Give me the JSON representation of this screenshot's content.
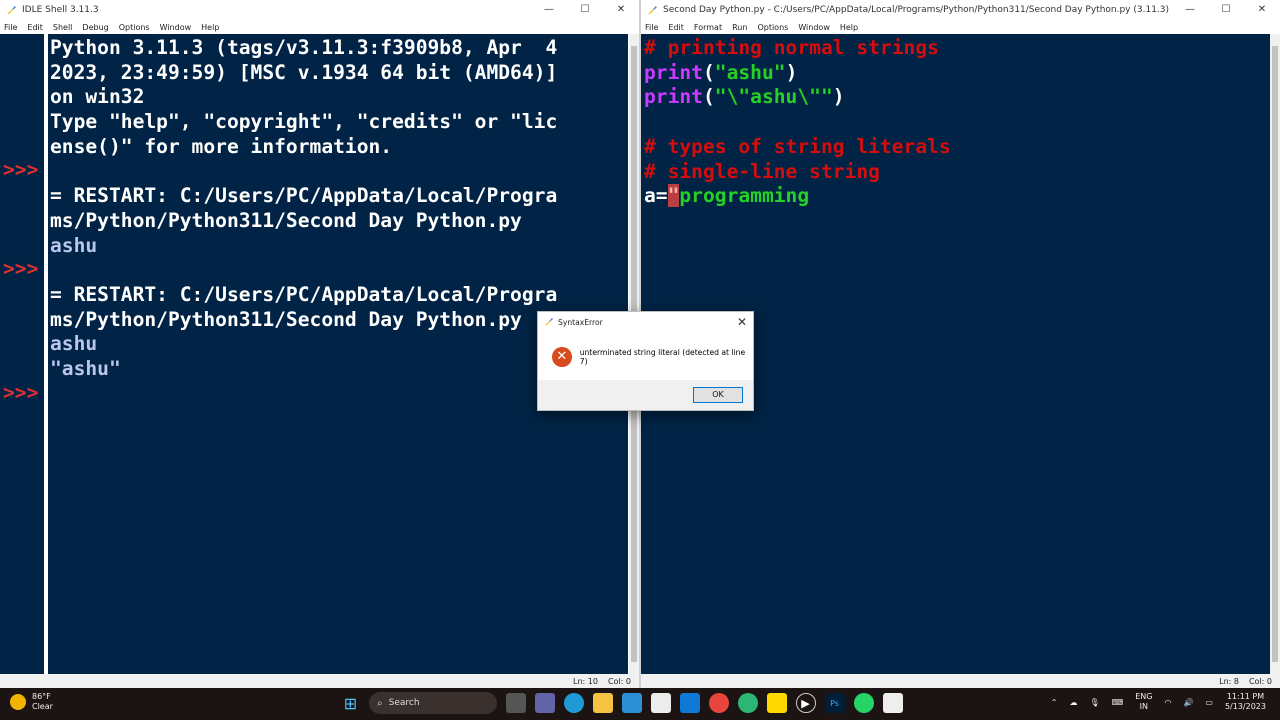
{
  "shell": {
    "title": "IDLE Shell 3.11.3",
    "menu": [
      "File",
      "Edit",
      "Shell",
      "Debug",
      "Options",
      "Window",
      "Help"
    ],
    "lines": [
      "Python 3.11.3 (tags/v3.11.3:f3909b8, Apr  4",
      "2023, 23:49:59) [MSC v.1934 64 bit (AMD64)]",
      "on win32",
      "Type \"help\", \"copyright\", \"credits\" or \"lic",
      "ense()\" for more information.",
      "",
      "= RESTART: C:/Users/PC/AppData/Local/Progra",
      "ms/Python/Python311/Second Day Python.py",
      "ashu",
      "",
      "= RESTART: C:/Users/PC/AppData/Local/Progra",
      "ms/Python/Python311/Second Day Python.py",
      "ashu",
      "\"ashu\"",
      ""
    ],
    "prompt": ">>>",
    "status": {
      "ln": "Ln: 10",
      "col": "Col: 0"
    }
  },
  "editor": {
    "title": "Second Day Python.py - C:/Users/PC/AppData/Local/Programs/Python/Python311/Second Day Python.py (3.11.3)",
    "menu": [
      "File",
      "Edit",
      "Format",
      "Run",
      "Options",
      "Window",
      "Help"
    ],
    "code": {
      "line1": "# printing normal strings",
      "line2_kw": "print",
      "line2_str": "\"ashu\"",
      "line3_kw": "print",
      "line3_str": "\"\\\"ashu\\\"\"",
      "line5": "# types of string literals",
      "line6": "# single-line string",
      "line7_prefix": "a=",
      "line7_quote": "\"",
      "line7_str": "programming"
    },
    "status": {
      "ln": "Ln: 8",
      "col": "Col: 0"
    }
  },
  "dialog": {
    "title": "SyntaxError",
    "message": "unterminated string literal (detected at line 7)",
    "ok_label": "OK"
  },
  "taskbar": {
    "weather_temp": "86°F",
    "weather_desc": "Clear",
    "search_label": "Search",
    "lang_top": "ENG",
    "lang_bottom": "IN",
    "time": "11:11 PM",
    "date": "5/13/2023"
  }
}
